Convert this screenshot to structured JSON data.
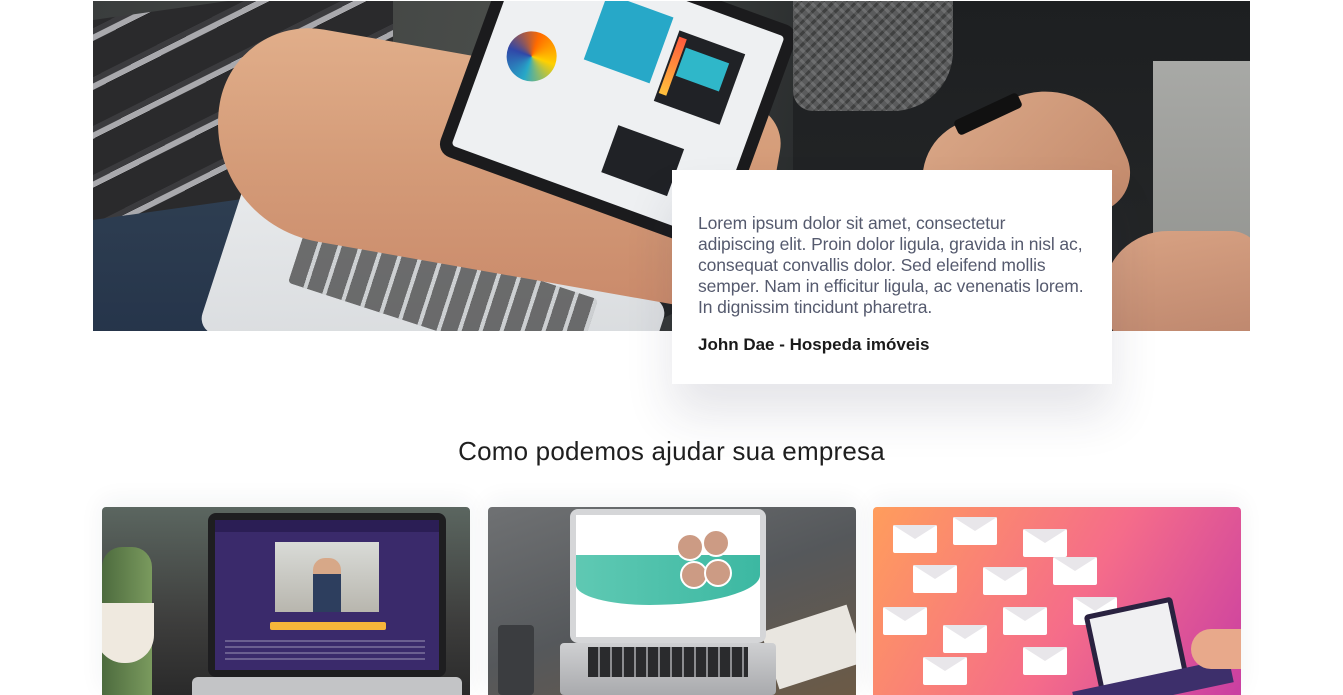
{
  "hero": {
    "image_alt": "people working with laptops"
  },
  "testimonial": {
    "quote": "Lorem ipsum dolor sit amet, consectetur adipiscing elit. Proin dolor ligula, gravida in nisl ac, consequat convallis dolor. Sed eleifend mollis semper. Nam in efficitur ligula, ac venenatis lorem. In dignissim tincidunt pharetra.",
    "author": "John Dae - Hospeda imóveis"
  },
  "services": {
    "title": "Como podemos ajudar sua empresa",
    "cards": [
      {
        "image": "landing-page-laptop-image"
      },
      {
        "image": "website-laptop-image"
      },
      {
        "image": "email-marketing-image"
      }
    ]
  },
  "colors": {
    "card_email_gradient_start": "#ff9d5c",
    "card_email_gradient_end": "#c93fa2",
    "title_text": "#1f1f1f",
    "quote_text": "#555a6e"
  }
}
